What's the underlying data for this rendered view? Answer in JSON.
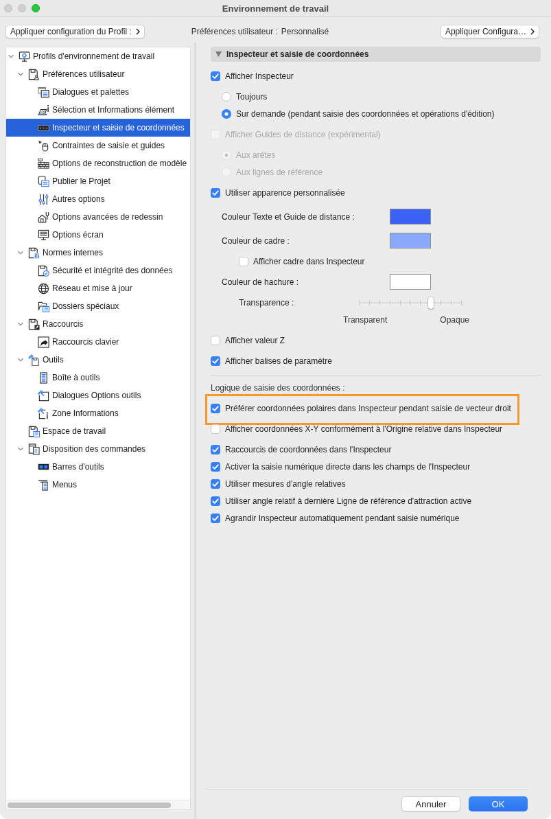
{
  "window": {
    "title": "Environnement de travail",
    "controls": [
      {
        "kind": "close",
        "active": false
      },
      {
        "kind": "minimize",
        "active": false
      },
      {
        "kind": "zoom",
        "active": true
      }
    ]
  },
  "toolbar": {
    "profile_button": "Appliquer configuration du Profil :",
    "status_label": "Préférences utilisateur :",
    "status_value": "Personnalisé",
    "apply_button": "Appliquer Configura…"
  },
  "sidebar": {
    "items": [
      {
        "label": "Profils d'environnement de travail",
        "expanded": true,
        "selected": false,
        "children": [
          {
            "label": "Préférences utilisateur",
            "expanded": true,
            "selected": false,
            "children": [
              {
                "label": "Dialogues et palettes",
                "selected": false
              },
              {
                "label": "Sélection et Informations élément",
                "selected": false
              },
              {
                "label": "Inspecteur et saisie de coordonnées",
                "selected": true
              },
              {
                "label": "Contraintes de saisie et guides",
                "selected": false
              },
              {
                "label": "Options de reconstruction de modèle",
                "selected": false
              },
              {
                "label": "Publier le Projet",
                "selected": false
              },
              {
                "label": "Autres options",
                "selected": false
              },
              {
                "label": "Options avancées de redessin",
                "selected": false
              },
              {
                "label": "Options écran",
                "selected": false
              }
            ]
          },
          {
            "label": "Normes internes",
            "expanded": true,
            "selected": false,
            "children": [
              {
                "label": "Sécurité et intégrité des données",
                "selected": false
              },
              {
                "label": "Réseau et mise à jour",
                "selected": false
              },
              {
                "label": "Dossiers spéciaux",
                "selected": false
              }
            ]
          },
          {
            "label": "Raccourcis",
            "expanded": true,
            "selected": false,
            "children": [
              {
                "label": "Raccourcis clavier",
                "selected": false
              }
            ]
          },
          {
            "label": "Outils",
            "expanded": true,
            "selected": false,
            "children": [
              {
                "label": "Boîte à outils",
                "selected": false
              },
              {
                "label": "Dialogues Options outils",
                "selected": false
              },
              {
                "label": "Zone Informations",
                "selected": false
              }
            ]
          },
          {
            "label": "Espace de travail",
            "selected": false
          },
          {
            "label": "Disposition des commandes",
            "expanded": true,
            "selected": false,
            "children": [
              {
                "label": "Barres d'outils",
                "selected": false
              },
              {
                "label": "Menus",
                "selected": false
              }
            ]
          }
        ]
      }
    ]
  },
  "panel": {
    "section": {
      "title": "Inspecteur et saisie de coordonnées",
      "expanded": true
    },
    "options": [
      {
        "kind": "checkbox",
        "label": "Afficher Inspecteur",
        "checked": true,
        "disabled": false,
        "children": [
          {
            "kind": "radio",
            "label": "Toujours",
            "selected": false,
            "disabled": false
          },
          {
            "kind": "radio",
            "label": "Sur demande (pendant saisie des coordonnées et opérations d'édition)",
            "selected": true,
            "disabled": false
          }
        ]
      },
      {
        "kind": "checkbox",
        "label": "Afficher Guides de distance (expérimental)",
        "checked": false,
        "disabled": true,
        "children": [
          {
            "kind": "radio",
            "label": "Aux arêtes",
            "selected": true,
            "disabled": true
          },
          {
            "kind": "radio",
            "label": "Aux lignes de référence",
            "selected": false,
            "disabled": true
          }
        ]
      },
      {
        "kind": "checkbox",
        "label": "Utiliser apparence personnalisée",
        "checked": true,
        "disabled": false,
        "children": [
          {
            "kind": "color",
            "label": "Couleur Texte et Guide de distance :",
            "color": "#3a62f6"
          },
          {
            "kind": "color",
            "label": "Couleur de cadre :",
            "color": "#89a9fb",
            "children": [
              {
                "kind": "checkbox",
                "label": "Afficher cadre dans Inspecteur",
                "checked": false,
                "disabled": false
              }
            ]
          },
          {
            "kind": "color",
            "label": "Couleur de hachure :",
            "color": "#ffffff",
            "children": [
              {
                "kind": "slider",
                "label": "Transparence :",
                "level": 0.7,
                "min_label": "Transparent",
                "max_label": "Opaque"
              }
            ]
          }
        ]
      },
      {
        "kind": "checkbox",
        "label": "Afficher valeur Z",
        "checked": false,
        "disabled": false
      },
      {
        "kind": "checkbox",
        "label": "Afficher balises de paramètre",
        "checked": true,
        "disabled": false
      }
    ],
    "coordinate_logic": {
      "heading": "Logique de saisie des coordonnées :",
      "options": [
        {
          "label": "Préférer coordonnées polaires dans Inspecteur pendant saisie de vecteur droit",
          "checked": true,
          "highlighted": true
        },
        {
          "label": "Afficher coordonnées X-Y conformément à l'Origine relative dans Inspecteur",
          "checked": false,
          "highlighted": false
        },
        {
          "label": "Raccourcis de coordonnées dans l'Inspecteur",
          "checked": true,
          "highlighted": false
        },
        {
          "label": "Activer la saisie numérique directe dans les champs de l'Inspecteur",
          "checked": true,
          "highlighted": false
        },
        {
          "label": "Utiliser mesures d'angle relatives",
          "checked": true,
          "highlighted": false
        },
        {
          "label": "Utiliser angle relatif à dernière Ligne de référence d'attraction active",
          "checked": true,
          "highlighted": false
        },
        {
          "label": "Agrandir Inspecteur automatiquement pendant saisie numérique",
          "checked": true,
          "highlighted": false
        }
      ]
    }
  },
  "buttons": [
    {
      "label": "Annuler",
      "kind": "default"
    },
    {
      "label": "OK",
      "kind": "primary"
    }
  ]
}
